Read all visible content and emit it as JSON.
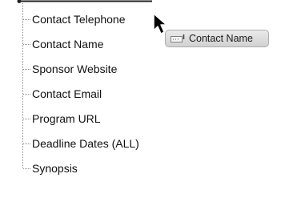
{
  "tree": {
    "items": [
      {
        "label": "Contact Telephone"
      },
      {
        "label": "Contact Name"
      },
      {
        "label": "Sponsor Website"
      },
      {
        "label": "Contact Email"
      },
      {
        "label": "Program URL"
      },
      {
        "label": "Deadline Dates (ALL)"
      },
      {
        "label": "Synopsis"
      }
    ]
  },
  "drag": {
    "label": "Contact Name",
    "icon": "field-grip-icon"
  },
  "cursor": {
    "icon": "arrow-pointer-icon"
  }
}
